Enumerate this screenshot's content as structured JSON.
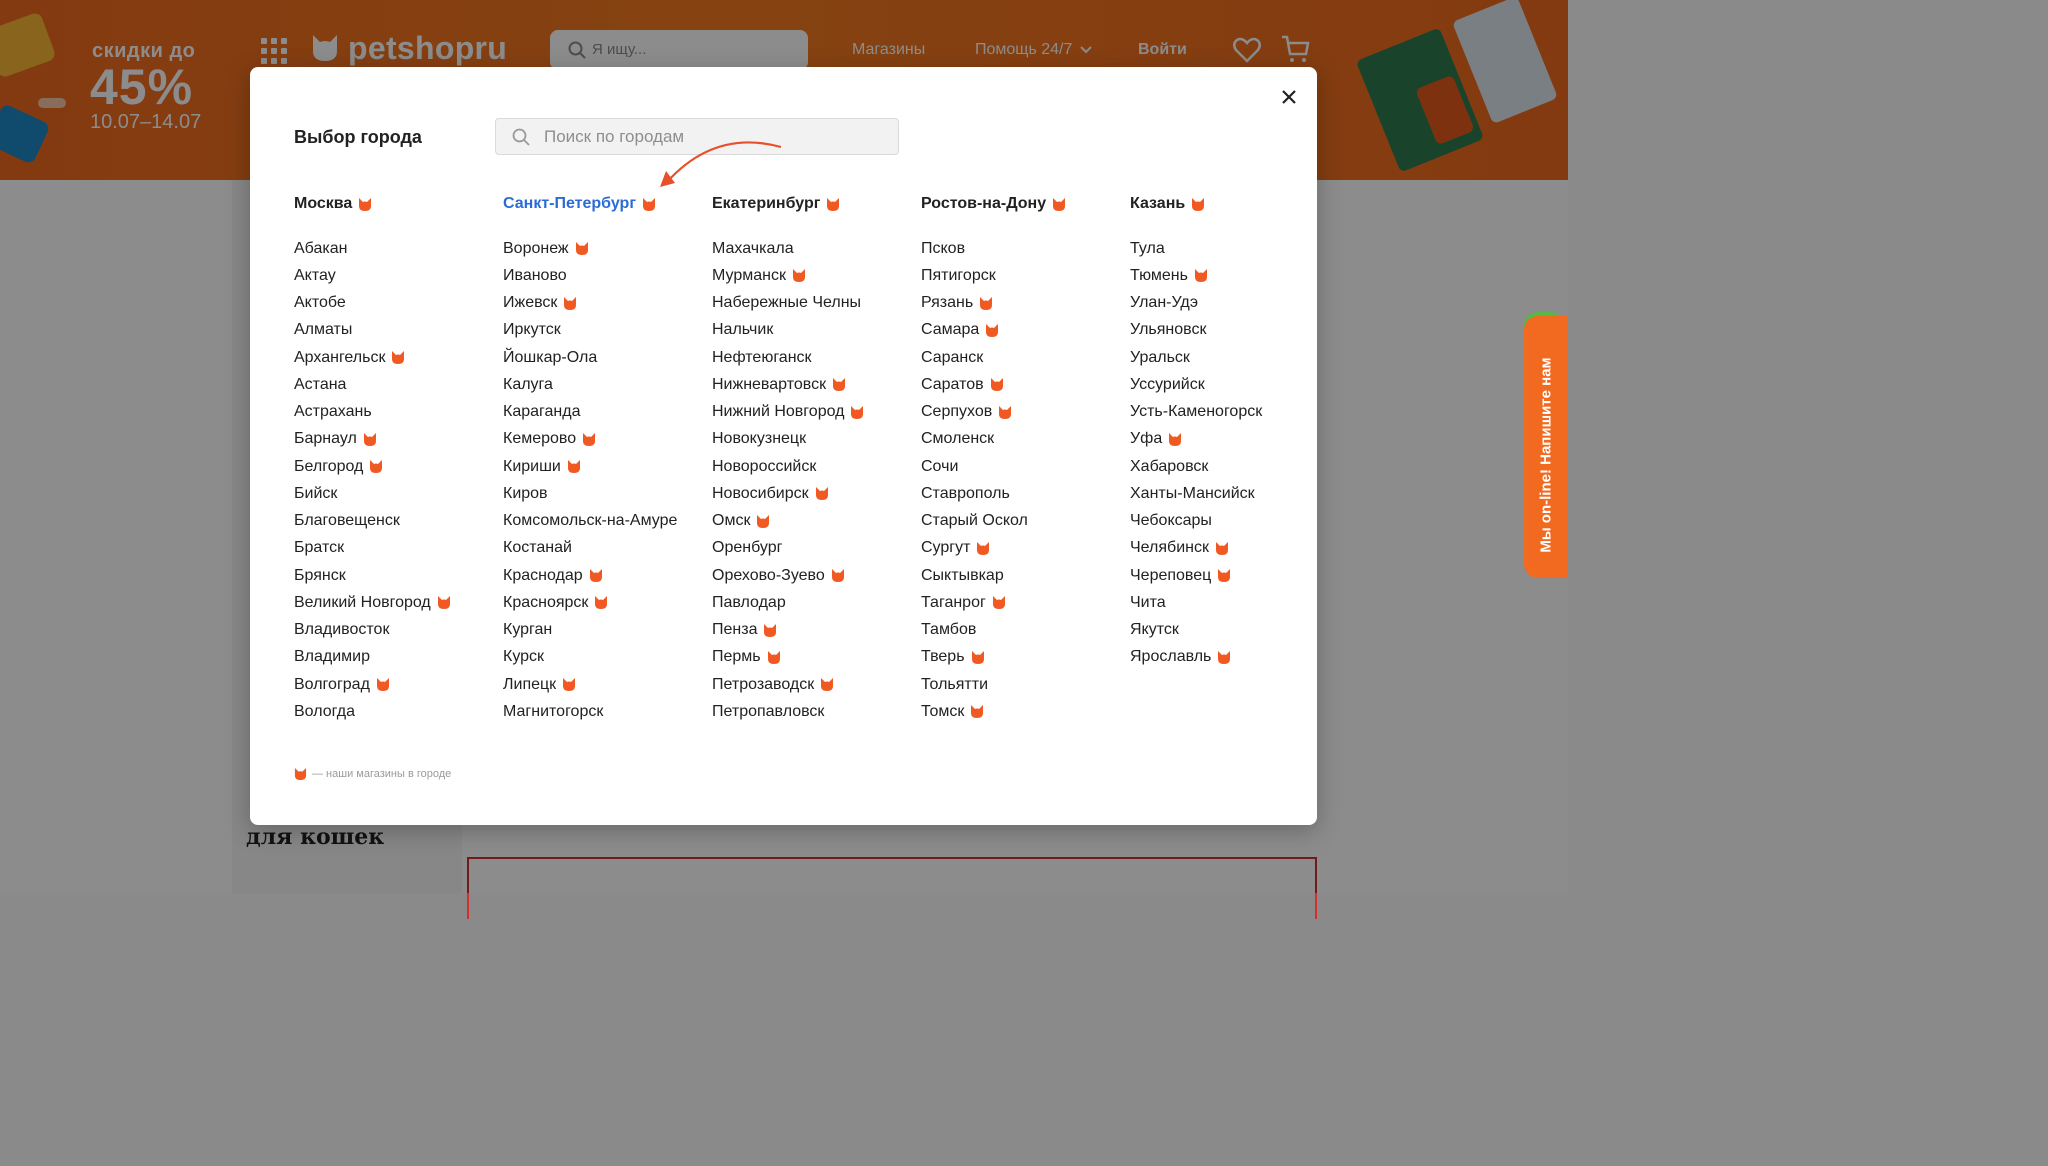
{
  "header": {
    "promo_small": "скидки до",
    "promo_big": "45%",
    "promo_dates": "10.07–14.07",
    "logo": "petshopru",
    "search_placeholder": "Я ищу...",
    "nav": {
      "stores": "Магазины",
      "help": "Помощь 24/7",
      "login": "Войти"
    }
  },
  "background": {
    "section_title": "для кошек"
  },
  "chat": {
    "label": "Мы on-line! Напишите нам"
  },
  "modal": {
    "title": "Выбор города",
    "search_placeholder": "Поиск по городам",
    "legend": "— наши магазины в городе",
    "columns": [
      {
        "head": {
          "name": "Москва",
          "store": true,
          "active": false
        },
        "cities": [
          {
            "name": "Абакан",
            "store": false
          },
          {
            "name": "Актау",
            "store": false
          },
          {
            "name": "Актобе",
            "store": false
          },
          {
            "name": "Алматы",
            "store": false
          },
          {
            "name": "Архангельск",
            "store": true
          },
          {
            "name": "Астана",
            "store": false
          },
          {
            "name": "Астрахань",
            "store": false
          },
          {
            "name": "Барнаул",
            "store": true
          },
          {
            "name": "Белгород",
            "store": true
          },
          {
            "name": "Бийск",
            "store": false
          },
          {
            "name": "Благовещенск",
            "store": false
          },
          {
            "name": "Братск",
            "store": false
          },
          {
            "name": "Брянск",
            "store": false
          },
          {
            "name": "Великий Новгород",
            "store": true
          },
          {
            "name": "Владивосток",
            "store": false
          },
          {
            "name": "Владимир",
            "store": false
          },
          {
            "name": "Волгоград",
            "store": true
          },
          {
            "name": "Вологда",
            "store": false
          }
        ]
      },
      {
        "head": {
          "name": "Санкт-Петербург",
          "store": true,
          "active": true
        },
        "cities": [
          {
            "name": "Воронеж",
            "store": true
          },
          {
            "name": "Иваново",
            "store": false
          },
          {
            "name": "Ижевск",
            "store": true
          },
          {
            "name": "Иркутск",
            "store": false
          },
          {
            "name": "Йошкар-Ола",
            "store": false
          },
          {
            "name": "Калуга",
            "store": false
          },
          {
            "name": "Караганда",
            "store": false
          },
          {
            "name": "Кемерово",
            "store": true
          },
          {
            "name": "Кириши",
            "store": true
          },
          {
            "name": "Киров",
            "store": false
          },
          {
            "name": "Комсомольск-на-Амуре",
            "store": false
          },
          {
            "name": "Костанай",
            "store": false
          },
          {
            "name": "Краснодар",
            "store": true
          },
          {
            "name": "Красноярск",
            "store": true
          },
          {
            "name": "Курган",
            "store": false
          },
          {
            "name": "Курск",
            "store": false
          },
          {
            "name": "Липецк",
            "store": true
          },
          {
            "name": "Магнитогорск",
            "store": false
          }
        ]
      },
      {
        "head": {
          "name": "Екатеринбург",
          "store": true,
          "active": false
        },
        "cities": [
          {
            "name": "Махачкала",
            "store": false
          },
          {
            "name": "Мурманск",
            "store": true
          },
          {
            "name": "Набережные Челны",
            "store": false
          },
          {
            "name": "Нальчик",
            "store": false
          },
          {
            "name": "Нефтеюганск",
            "store": false
          },
          {
            "name": "Нижневартовск",
            "store": true
          },
          {
            "name": "Нижний Новгород",
            "store": true
          },
          {
            "name": "Новокузнецк",
            "store": false
          },
          {
            "name": "Новороссийск",
            "store": false
          },
          {
            "name": "Новосибирск",
            "store": true
          },
          {
            "name": "Омск",
            "store": true
          },
          {
            "name": "Оренбург",
            "store": false
          },
          {
            "name": "Орехово-Зуево",
            "store": true
          },
          {
            "name": "Павлодар",
            "store": false
          },
          {
            "name": "Пенза",
            "store": true
          },
          {
            "name": "Пермь",
            "store": true
          },
          {
            "name": "Петрозаводск",
            "store": true
          },
          {
            "name": "Петропавловск",
            "store": false
          }
        ]
      },
      {
        "head": {
          "name": "Ростов-на-Дону",
          "store": true,
          "active": false
        },
        "cities": [
          {
            "name": "Псков",
            "store": false
          },
          {
            "name": "Пятигорск",
            "store": false
          },
          {
            "name": "Рязань",
            "store": true
          },
          {
            "name": "Самара",
            "store": true
          },
          {
            "name": "Саранск",
            "store": false
          },
          {
            "name": "Саратов",
            "store": true
          },
          {
            "name": "Серпухов",
            "store": true
          },
          {
            "name": "Смоленск",
            "store": false
          },
          {
            "name": "Сочи",
            "store": false
          },
          {
            "name": "Ставрополь",
            "store": false
          },
          {
            "name": "Старый Оскол",
            "store": false
          },
          {
            "name": "Сургут",
            "store": true
          },
          {
            "name": "Сыктывкар",
            "store": false
          },
          {
            "name": "Таганрог",
            "store": true
          },
          {
            "name": "Тамбов",
            "store": false
          },
          {
            "name": "Тверь",
            "store": true
          },
          {
            "name": "Тольятти",
            "store": false
          },
          {
            "name": "Томск",
            "store": true
          }
        ]
      },
      {
        "head": {
          "name": "Казань",
          "store": true,
          "active": false
        },
        "cities": [
          {
            "name": "Тула",
            "store": false
          },
          {
            "name": "Тюмень",
            "store": true
          },
          {
            "name": "Улан-Удэ",
            "store": false
          },
          {
            "name": "Ульяновск",
            "store": false
          },
          {
            "name": "Уральск",
            "store": false
          },
          {
            "name": "Уссурийск",
            "store": false
          },
          {
            "name": "Усть-Каменогорск",
            "store": false
          },
          {
            "name": "Уфа",
            "store": true
          },
          {
            "name": "Хабаровск",
            "store": false
          },
          {
            "name": "Ханты-Мансийск",
            "store": false
          },
          {
            "name": "Чебоксары",
            "store": false
          },
          {
            "name": "Челябинск",
            "store": true
          },
          {
            "name": "Череповец",
            "store": true
          },
          {
            "name": "Чита",
            "store": false
          },
          {
            "name": "Якутск",
            "store": false
          },
          {
            "name": "Ярославль",
            "store": true
          }
        ]
      }
    ]
  },
  "colors": {
    "brand_orange": "#f26a1f",
    "cat_icon": "#f05a22",
    "active_link": "#2b6bd6",
    "chat_green": "#56b847"
  },
  "icons": {
    "store_marker": "cat-head-icon",
    "close": "close-icon",
    "search": "search-icon"
  }
}
